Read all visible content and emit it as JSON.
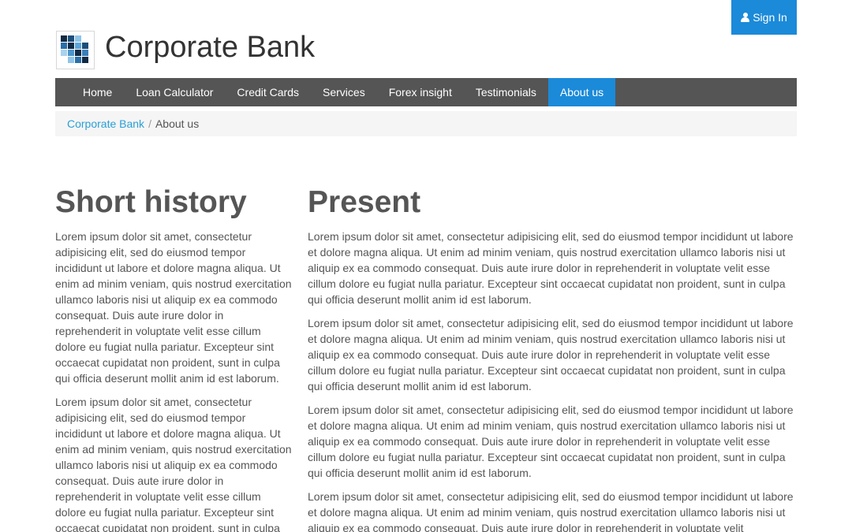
{
  "header": {
    "brand": "Corporate Bank",
    "signin_label": "Sign In",
    "logo_icon": "pixel-grid-logo",
    "user_icon": "user-icon"
  },
  "nav": {
    "items": [
      {
        "label": "Home"
      },
      {
        "label": "Loan Calculator"
      },
      {
        "label": "Credit Cards"
      },
      {
        "label": "Services"
      },
      {
        "label": "Forex insight"
      },
      {
        "label": "Testimonials"
      },
      {
        "label": "About us",
        "active": true
      }
    ]
  },
  "breadcrumb": {
    "home": "Corporate Bank",
    "separator": "/",
    "current": "About us"
  },
  "history": {
    "title": "Short history",
    "paragraphs": [
      "Lorem ipsum dolor sit amet, consectetur adipisicing elit, sed do eiusmod tempor incididunt ut labore et dolore magna aliqua. Ut enim ad minim veniam, quis nostrud exercitation ullamco laboris nisi ut aliquip ex ea commodo consequat. Duis aute irure dolor in reprehenderit in voluptate velit esse cillum dolore eu fugiat nulla pariatur. Excepteur sint occaecat cupidatat non proident, sunt in culpa qui officia deserunt mollit anim id est laborum.",
      "Lorem ipsum dolor sit amet, consectetur adipisicing elit, sed do eiusmod tempor incididunt ut labore et dolore magna aliqua. Ut enim ad minim veniam, quis nostrud exercitation ullamco laboris nisi ut aliquip ex ea commodo consequat. Duis aute irure dolor in reprehenderit in voluptate velit esse cillum dolore eu fugiat nulla pariatur. Excepteur sint occaecat cupidatat non proident, sunt in culpa"
    ]
  },
  "present": {
    "title": "Present",
    "paragraphs": [
      "Lorem ipsum dolor sit amet, consectetur adipisicing elit, sed do eiusmod tempor incididunt ut labore et dolore magna aliqua. Ut enim ad minim veniam, quis nostrud exercitation ullamco laboris nisi ut aliquip ex ea commodo consequat. Duis aute irure dolor in reprehenderit in voluptate velit esse cillum dolore eu fugiat nulla pariatur. Excepteur sint occaecat cupidatat non proident, sunt in culpa qui officia deserunt mollit anim id est laborum.",
      "Lorem ipsum dolor sit amet, consectetur adipisicing elit, sed do eiusmod tempor incididunt ut labore et dolore magna aliqua. Ut enim ad minim veniam, quis nostrud exercitation ullamco laboris nisi ut aliquip ex ea commodo consequat. Duis aute irure dolor in reprehenderit in voluptate velit esse cillum dolore eu fugiat nulla pariatur. Excepteur sint occaecat cupidatat non proident, sunt in culpa qui officia deserunt mollit anim id est laborum.",
      "Lorem ipsum dolor sit amet, consectetur adipisicing elit, sed do eiusmod tempor incididunt ut labore et dolore magna aliqua. Ut enim ad minim veniam, quis nostrud exercitation ullamco laboris nisi ut aliquip ex ea commodo consequat. Duis aute irure dolor in reprehenderit in voluptate velit esse cillum dolore eu fugiat nulla pariatur. Excepteur sint occaecat cupidatat non proident, sunt in culpa qui officia deserunt mollit anim id est laborum.",
      "Lorem ipsum dolor sit amet, consectetur adipisicing elit, sed do eiusmod tempor incididunt ut labore et dolore magna aliqua. Ut enim ad minim veniam, quis nostrud exercitation ullamco laboris nisi ut aliquip ex ea commodo consequat. Duis aute irure dolor in reprehenderit in voluptate velit"
    ]
  },
  "colors": {
    "accent": "#1b8ad9",
    "nav_bg": "#555555",
    "link": "#2a9fd6",
    "breadcrumb_bg": "#f5f5f5"
  }
}
